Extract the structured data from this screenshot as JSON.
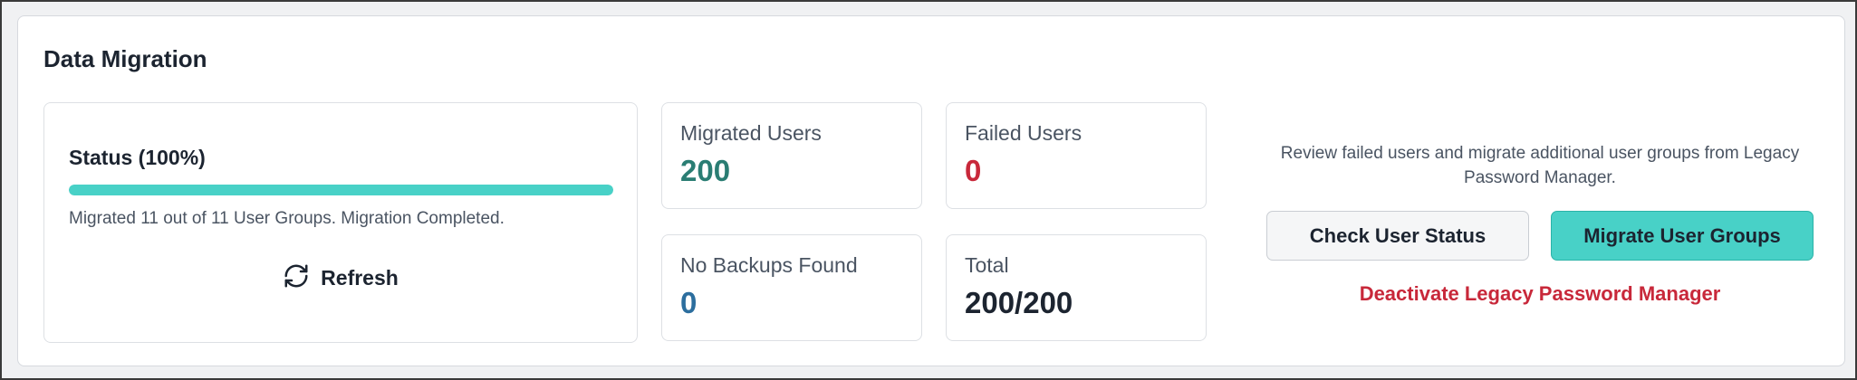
{
  "panel": {
    "title": "Data Migration"
  },
  "status": {
    "title": "Status (100%)",
    "progress_percent": 100,
    "message": "Migrated 11 out of 11 User Groups. Migration Completed.",
    "refresh_label": "Refresh",
    "refresh_icon": "refresh-icon"
  },
  "stats": {
    "migrated": {
      "label": "Migrated Users",
      "value": "200",
      "color": "#2a7d73"
    },
    "failed": {
      "label": "Failed Users",
      "value": "0",
      "color": "#c8283a"
    },
    "no_backups": {
      "label": "No Backups Found",
      "value": "0",
      "color": "#2c6e9e"
    },
    "total": {
      "label": "Total",
      "value": "200/200",
      "color": "#1c2430"
    }
  },
  "actions": {
    "description": "Review failed users and migrate additional user groups from Legacy Password Manager.",
    "check_status_label": "Check User Status",
    "migrate_groups_label": "Migrate User Groups",
    "deactivate_label": "Deactivate Legacy Password Manager"
  },
  "colors": {
    "accent": "#48d1c7",
    "danger": "#c8283a"
  }
}
